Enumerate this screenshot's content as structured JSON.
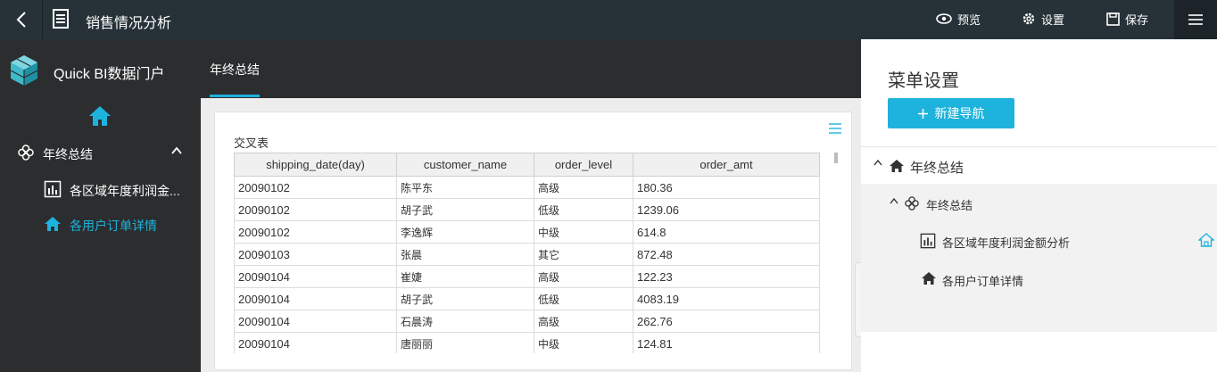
{
  "topbar": {
    "title": "销售情况分析",
    "actions": {
      "preview": "预览",
      "settings": "设置",
      "save": "保存"
    }
  },
  "portal": {
    "brand": "Quick BI数据门户",
    "active_tab": "年终总结"
  },
  "sidebar": {
    "group_label": "年终总结",
    "items": [
      {
        "label": "各区域年度利润金..."
      },
      {
        "label": "各用户订单详情"
      }
    ]
  },
  "card": {
    "title": "交叉表",
    "columns": [
      "shipping_date(day)",
      "customer_name",
      "order_level",
      "order_amt"
    ],
    "rows": [
      [
        "20090102",
        "陈平东",
        "高级",
        "180.36"
      ],
      [
        "20090102",
        "胡子武",
        "低级",
        "1239.06"
      ],
      [
        "20090102",
        "李逸辉",
        "中级",
        "614.8"
      ],
      [
        "20090103",
        "张晨",
        "其它",
        "872.48"
      ],
      [
        "20090104",
        "崔婕",
        "高级",
        "122.23"
      ],
      [
        "20090104",
        "胡子武",
        "低级",
        "4083.19"
      ],
      [
        "20090104",
        "石晨涛",
        "高级",
        "262.76"
      ],
      [
        "20090104",
        "唐丽丽",
        "中级",
        "124.81"
      ]
    ]
  },
  "panel": {
    "title": "菜单设置",
    "new_nav_button": "新建导航",
    "tree": {
      "root": "年终总结",
      "group": "年终总结",
      "items": [
        "各区域年度利润金额分析",
        "各用户订单详情"
      ]
    }
  },
  "colors": {
    "accent": "#1eb3dc",
    "topbar_bg": "#263238",
    "sidebar_bg": "#2b2d2f"
  }
}
